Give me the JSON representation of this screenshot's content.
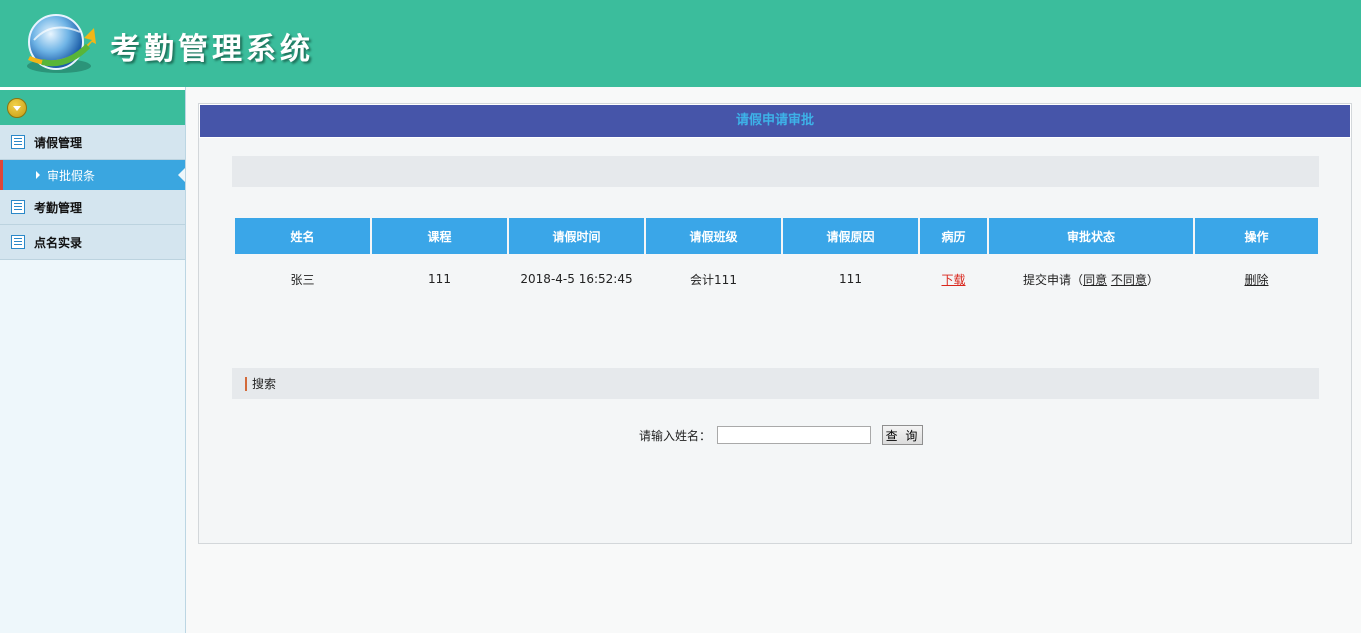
{
  "header": {
    "title": "考勤管理系统"
  },
  "sidebar": {
    "groups": [
      {
        "label": "请假管理"
      },
      {
        "label": "考勤管理"
      },
      {
        "label": "点名实录"
      }
    ],
    "active_sub": {
      "label": "审批假条"
    }
  },
  "panel": {
    "title": "请假申请审批"
  },
  "table": {
    "headers": [
      "姓名",
      "课程",
      "请假时间",
      "请假班级",
      "请假原因",
      "病历",
      "审批状态",
      "操作"
    ],
    "rows": [
      {
        "name": "张三",
        "course": "111",
        "time": "2018-4-5 16:52:45",
        "class": "会计111",
        "reason": "111",
        "record": "下载",
        "status_prefix": "提交申请（",
        "agree": "同意",
        "disagree": "不同意",
        "status_suffix": "）",
        "action": "删除"
      }
    ]
  },
  "search": {
    "section_label": "搜索",
    "field_label": "请输入姓名：",
    "value": "",
    "button": "查 询"
  },
  "colors": {
    "header_bg": "#3bbd9c",
    "panel_title_bg": "#4655a9",
    "table_header_bg": "#3aa6e8",
    "active_nav_bg": "#3aa6e0",
    "link_red": "#d9261c"
  }
}
